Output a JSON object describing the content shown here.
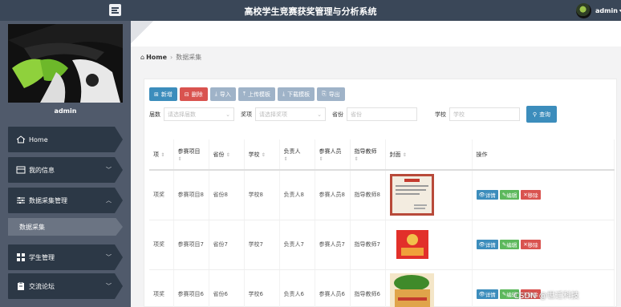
{
  "header": {
    "title": "高校学生竞赛获奖管理与分析系统",
    "user": "admin"
  },
  "sidebar": {
    "username": "admin",
    "items": [
      {
        "label": "Home",
        "icon": "home-icon"
      },
      {
        "label": "我的信息",
        "icon": "profile-icon"
      },
      {
        "label": "数据采集管理",
        "icon": "sliders-icon"
      },
      {
        "label": "学生管理",
        "icon": "grid-icon"
      },
      {
        "label": "交流论坛",
        "icon": "forum-icon"
      }
    ],
    "sub_item": "数据采集"
  },
  "breadcrumb": {
    "home": "Home",
    "current": "数据采集"
  },
  "toolbar": {
    "add": "新增",
    "delete": "删除",
    "import": "导入",
    "upload_template": "上传模板",
    "download_template": "下载模板",
    "export": "导出"
  },
  "filters": {
    "session_label": "届数",
    "session_placeholder": "请选择届数",
    "award_label": "奖项",
    "award_placeholder": "请选择奖项",
    "province_label": "省份",
    "province_placeholder": "省份",
    "school_label": "学校",
    "school_placeholder": "学校",
    "search": "查询"
  },
  "table": {
    "headers": [
      "项",
      "参赛项目",
      "省份",
      "学校",
      "负责人",
      "参赛人员",
      "指导教师",
      "封面",
      "操作"
    ],
    "rows": [
      {
        "award": "项奖",
        "project": "参赛项目8",
        "province": "省份8",
        "school": "学校8",
        "leader": "负责人8",
        "members": "参赛人员8",
        "teacher": "指导教师8"
      },
      {
        "award": "项奖",
        "project": "参赛项目7",
        "province": "省份7",
        "school": "学校7",
        "leader": "负责人7",
        "members": "参赛人员7",
        "teacher": "指导教师7"
      },
      {
        "award": "项奖",
        "project": "参赛项目6",
        "province": "省份6",
        "school": "学校6",
        "leader": "负责人6",
        "members": "参赛人员6",
        "teacher": "指导教师6"
      }
    ],
    "actions": {
      "detail": "详情",
      "edit": "编辑",
      "remove": "移除"
    }
  },
  "watermark": "CSDN @世迁科技"
}
